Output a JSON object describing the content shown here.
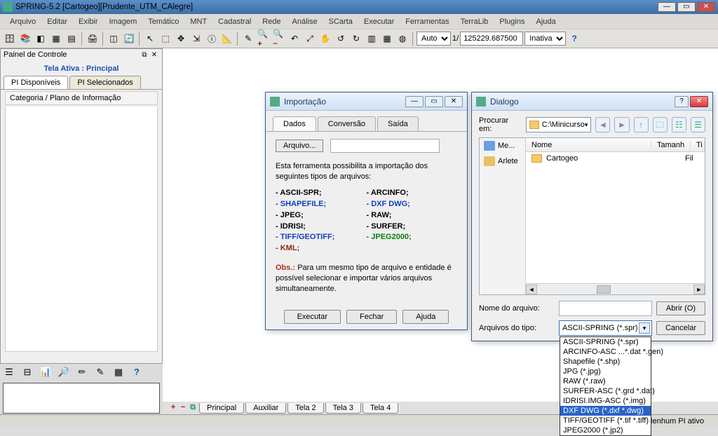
{
  "title": "SPRING-5.2 [Cartogeo][Prudente_UTM_CAlegre]",
  "menu": [
    "Arquivo",
    "Editar",
    "Exibir",
    "Imagem",
    "Temático",
    "MNT",
    "Cadastral",
    "Rede",
    "Análise",
    "SCarta",
    "Executar",
    "Ferramentas",
    "TerraLib",
    "Plugins",
    "Ajuda"
  ],
  "toolbar": {
    "scale_mode": "Auto",
    "scale_idx": "1/",
    "scale_val": "125229.687500",
    "status": "Inativa"
  },
  "panel": {
    "title": "Painel de Controle",
    "tela_ativa_label": "Tela Ativa",
    "tela_ativa_name": "Principal",
    "tab_disp": "PI Disponíveis",
    "tab_sel": "PI Selecionados",
    "list_header": "Categoria / Plano de Informação"
  },
  "import": {
    "title": "Importação",
    "tab_dados": "Dados",
    "tab_conv": "Conversão",
    "tab_saida": "Saída",
    "arquivo": "Arquivo...",
    "desc": "Esta ferramenta possibilita a importação dos seguintes tipos de arquivos:",
    "left": [
      "ASCII-SPR;",
      "SHAPEFILE;",
      "JPEG;",
      "IDRISI;",
      "TIFF/GEOTIFF;",
      "KML;"
    ],
    "right": [
      "ARCINFO;",
      "DXF DWG;",
      "RAW;",
      "SURFER;",
      "JPEG2000;"
    ],
    "obs_label": "Obs.:",
    "obs_text": "Para um mesmo tipo de arquivo e entidade é possível selecionar e importar vários arquivos simultaneamente.",
    "btn_exec": "Executar",
    "btn_close": "Fechar",
    "btn_help": "Ajuda"
  },
  "dialog": {
    "title": "Dialogo",
    "look_in": "Procurar em:",
    "path": "C:\\Minicurso",
    "hdr_name": "Nome",
    "hdr_size": "Tamanh",
    "hdr_type": "Ti",
    "places": [
      "Me...",
      "Arlete"
    ],
    "files": [
      "Cartogeo"
    ],
    "file_type_right": "Fil",
    "filename_label": "Nome do arquivo:",
    "filetype_label": "Arquivos do tipo:",
    "btn_open": "Abrir (O)",
    "btn_cancel": "Cancelar",
    "combo_value": "ASCII-SPRING (*.spr)",
    "options": [
      "ASCII-SPRING (*.spr)",
      "ARCINFO-ASC ...*.dat *.gen)",
      "Shapefile (*.shp)",
      "JPG (*.jpg)",
      "RAW (*.raw)",
      "SURFER-ASC (*.grd *.dat)",
      "IDRISI.IMG-ASC (*.img)",
      "DXF DWG (*.dxf *.dwg)",
      "TIFF/GEOTIFF (*.tif *.tiff)",
      "JPEG2000 (*.jp2)"
    ],
    "selected_index": 7
  },
  "bottom_tabs": [
    "Principal",
    "Auxiliar",
    "Tela 2",
    "Tela 3",
    "Tela 4"
  ],
  "status": "Nenhum PI ativo"
}
